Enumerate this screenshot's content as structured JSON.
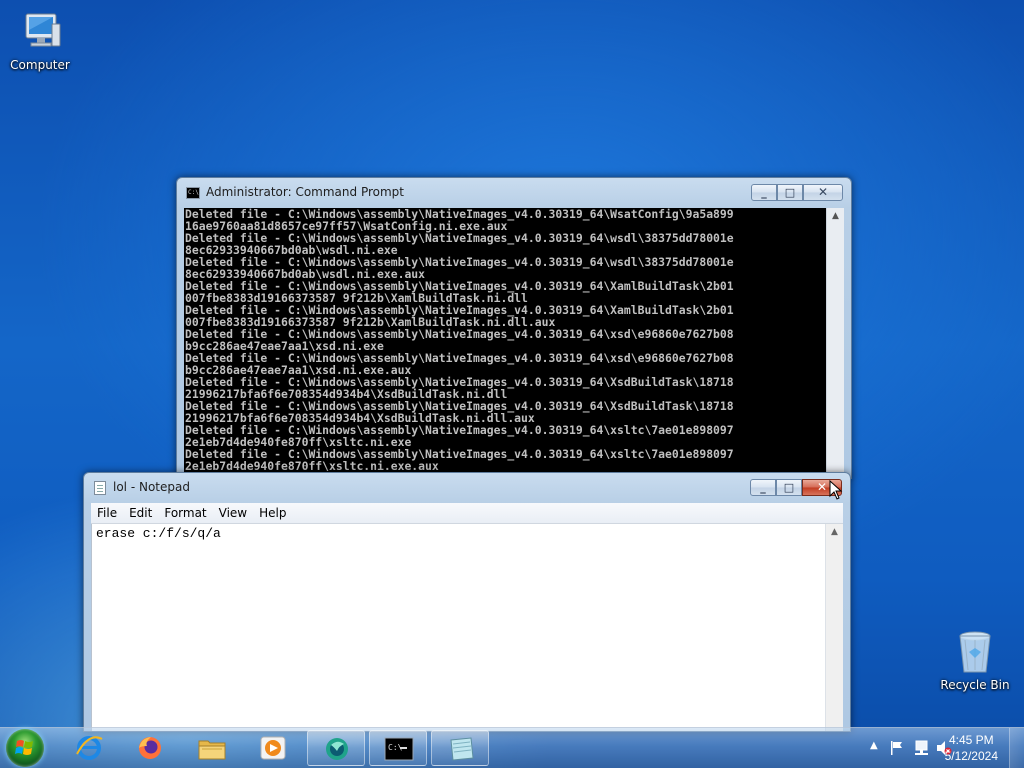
{
  "desktop": {
    "icons": [
      {
        "label": "Computer",
        "icon": "computer-icon"
      },
      {
        "label": "Recycle Bin",
        "icon": "recycle-bin-icon"
      }
    ]
  },
  "cmd_window": {
    "title": "Administrator: Command Prompt",
    "lines": [
      "Deleted file - C:\\Windows\\assembly\\NativeImages_v4.0.30319_64\\WsatConfig\\9a5a899",
      "16ae9760aa81d8657ce97ff57\\WsatConfig.ni.exe.aux",
      "Deleted file - C:\\Windows\\assembly\\NativeImages_v4.0.30319_64\\wsdl\\38375dd78001e",
      "8ec62933940667bd0ab\\wsdl.ni.exe",
      "Deleted file - C:\\Windows\\assembly\\NativeImages_v4.0.30319_64\\wsdl\\38375dd78001e",
      "8ec62933940667bd0ab\\wsdl.ni.exe.aux",
      "Deleted file - C:\\Windows\\assembly\\NativeImages_v4.0.30319_64\\XamlBuildTask\\2b01",
      "007fbe8383d19166373587 9f212b\\XamlBuildTask.ni.dll",
      "Deleted file - C:\\Windows\\assembly\\NativeImages_v4.0.30319_64\\XamlBuildTask\\2b01",
      "007fbe8383d19166373587 9f212b\\XamlBuildTask.ni.dll.aux",
      "Deleted file - C:\\Windows\\assembly\\NativeImages_v4.0.30319_64\\xsd\\e96860e7627b08",
      "b9cc286ae47eae7aa1\\xsd.ni.exe",
      "Deleted file - C:\\Windows\\assembly\\NativeImages_v4.0.30319_64\\xsd\\e96860e7627b08",
      "b9cc286ae47eae7aa1\\xsd.ni.exe.aux",
      "Deleted file - C:\\Windows\\assembly\\NativeImages_v4.0.30319_64\\XsdBuildTask\\18718",
      "21996217bfa6f6e708354d934b4\\XsdBuildTask.ni.dll",
      "Deleted file - C:\\Windows\\assembly\\NativeImages_v4.0.30319_64\\XsdBuildTask\\18718",
      "21996217bfa6f6e708354d934b4\\XsdBuildTask.ni.dll.aux",
      "Deleted file - C:\\Windows\\assembly\\NativeImages_v4.0.30319_64\\xsltc\\7ae01e898097",
      "2e1eb7d4de940fe870ff\\xsltc.ni.exe",
      "Deleted file - C:\\Windows\\assembly\\NativeImages_v4.0.30319_64\\xsltc\\7ae01e898097",
      "2e1eb7d4de940fe870ff\\xsltc.ni.exe.aux"
    ]
  },
  "notepad_window": {
    "title": "lol - Notepad",
    "menu": [
      "File",
      "Edit",
      "Format",
      "View",
      "Help"
    ],
    "content": "erase c:/f/s/q/a"
  },
  "taskbar": {
    "buttons": [
      {
        "icon": "internet-explorer-icon"
      },
      {
        "icon": "firefox-icon"
      },
      {
        "icon": "file-explorer-icon"
      },
      {
        "icon": "media-player-icon"
      },
      {
        "icon": "app-icon",
        "active": true
      },
      {
        "icon": "command-prompt-icon",
        "active": true
      },
      {
        "icon": "notepad-icon",
        "active": true
      }
    ],
    "clock": {
      "time": "4:45 PM",
      "date": "5/12/2024"
    }
  },
  "colors": {
    "desktop": "#1466c8",
    "console_bg": "#000000",
    "console_text": "#c0c0c0",
    "close_button": "#c23c22"
  }
}
